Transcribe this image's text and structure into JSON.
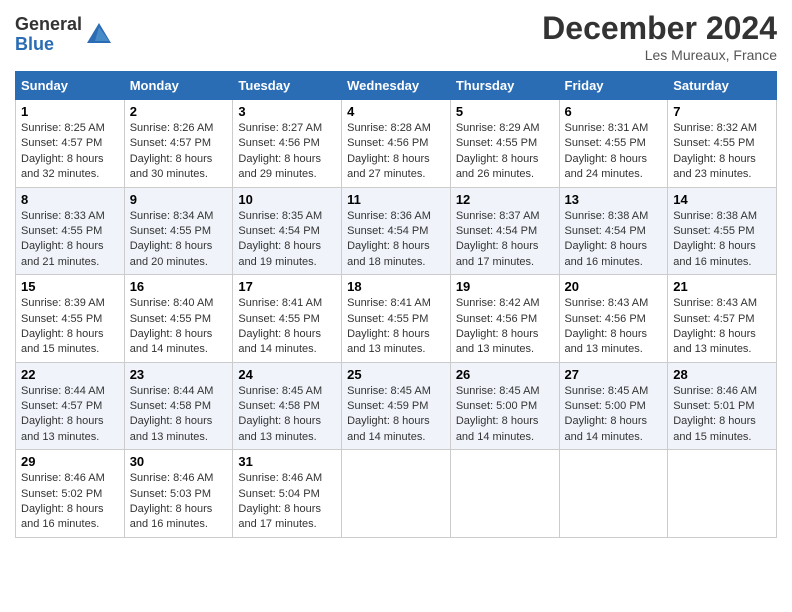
{
  "logo": {
    "general": "General",
    "blue": "Blue"
  },
  "header": {
    "title": "December 2024",
    "location": "Les Mureaux, France"
  },
  "days_of_week": [
    "Sunday",
    "Monday",
    "Tuesday",
    "Wednesday",
    "Thursday",
    "Friday",
    "Saturday"
  ],
  "weeks": [
    [
      {
        "day": 1,
        "sunrise": "8:25 AM",
        "sunset": "4:57 PM",
        "daylight": "8 hours and 32 minutes."
      },
      {
        "day": 2,
        "sunrise": "8:26 AM",
        "sunset": "4:57 PM",
        "daylight": "8 hours and 30 minutes."
      },
      {
        "day": 3,
        "sunrise": "8:27 AM",
        "sunset": "4:56 PM",
        "daylight": "8 hours and 29 minutes."
      },
      {
        "day": 4,
        "sunrise": "8:28 AM",
        "sunset": "4:56 PM",
        "daylight": "8 hours and 27 minutes."
      },
      {
        "day": 5,
        "sunrise": "8:29 AM",
        "sunset": "4:55 PM",
        "daylight": "8 hours and 26 minutes."
      },
      {
        "day": 6,
        "sunrise": "8:31 AM",
        "sunset": "4:55 PM",
        "daylight": "8 hours and 24 minutes."
      },
      {
        "day": 7,
        "sunrise": "8:32 AM",
        "sunset": "4:55 PM",
        "daylight": "8 hours and 23 minutes."
      }
    ],
    [
      {
        "day": 8,
        "sunrise": "8:33 AM",
        "sunset": "4:55 PM",
        "daylight": "8 hours and 21 minutes."
      },
      {
        "day": 9,
        "sunrise": "8:34 AM",
        "sunset": "4:55 PM",
        "daylight": "8 hours and 20 minutes."
      },
      {
        "day": 10,
        "sunrise": "8:35 AM",
        "sunset": "4:54 PM",
        "daylight": "8 hours and 19 minutes."
      },
      {
        "day": 11,
        "sunrise": "8:36 AM",
        "sunset": "4:54 PM",
        "daylight": "8 hours and 18 minutes."
      },
      {
        "day": 12,
        "sunrise": "8:37 AM",
        "sunset": "4:54 PM",
        "daylight": "8 hours and 17 minutes."
      },
      {
        "day": 13,
        "sunrise": "8:38 AM",
        "sunset": "4:54 PM",
        "daylight": "8 hours and 16 minutes."
      },
      {
        "day": 14,
        "sunrise": "8:38 AM",
        "sunset": "4:55 PM",
        "daylight": "8 hours and 16 minutes."
      }
    ],
    [
      {
        "day": 15,
        "sunrise": "8:39 AM",
        "sunset": "4:55 PM",
        "daylight": "8 hours and 15 minutes."
      },
      {
        "day": 16,
        "sunrise": "8:40 AM",
        "sunset": "4:55 PM",
        "daylight": "8 hours and 14 minutes."
      },
      {
        "day": 17,
        "sunrise": "8:41 AM",
        "sunset": "4:55 PM",
        "daylight": "8 hours and 14 minutes."
      },
      {
        "day": 18,
        "sunrise": "8:41 AM",
        "sunset": "4:55 PM",
        "daylight": "8 hours and 13 minutes."
      },
      {
        "day": 19,
        "sunrise": "8:42 AM",
        "sunset": "4:56 PM",
        "daylight": "8 hours and 13 minutes."
      },
      {
        "day": 20,
        "sunrise": "8:43 AM",
        "sunset": "4:56 PM",
        "daylight": "8 hours and 13 minutes."
      },
      {
        "day": 21,
        "sunrise": "8:43 AM",
        "sunset": "4:57 PM",
        "daylight": "8 hours and 13 minutes."
      }
    ],
    [
      {
        "day": 22,
        "sunrise": "8:44 AM",
        "sunset": "4:57 PM",
        "daylight": "8 hours and 13 minutes."
      },
      {
        "day": 23,
        "sunrise": "8:44 AM",
        "sunset": "4:58 PM",
        "daylight": "8 hours and 13 minutes."
      },
      {
        "day": 24,
        "sunrise": "8:45 AM",
        "sunset": "4:58 PM",
        "daylight": "8 hours and 13 minutes."
      },
      {
        "day": 25,
        "sunrise": "8:45 AM",
        "sunset": "4:59 PM",
        "daylight": "8 hours and 14 minutes."
      },
      {
        "day": 26,
        "sunrise": "8:45 AM",
        "sunset": "5:00 PM",
        "daylight": "8 hours and 14 minutes."
      },
      {
        "day": 27,
        "sunrise": "8:45 AM",
        "sunset": "5:00 PM",
        "daylight": "8 hours and 14 minutes."
      },
      {
        "day": 28,
        "sunrise": "8:46 AM",
        "sunset": "5:01 PM",
        "daylight": "8 hours and 15 minutes."
      }
    ],
    [
      {
        "day": 29,
        "sunrise": "8:46 AM",
        "sunset": "5:02 PM",
        "daylight": "8 hours and 16 minutes."
      },
      {
        "day": 30,
        "sunrise": "8:46 AM",
        "sunset": "5:03 PM",
        "daylight": "8 hours and 16 minutes."
      },
      {
        "day": 31,
        "sunrise": "8:46 AM",
        "sunset": "5:04 PM",
        "daylight": "8 hours and 17 minutes."
      },
      null,
      null,
      null,
      null
    ]
  ],
  "labels": {
    "sunrise": "Sunrise:",
    "sunset": "Sunset:",
    "daylight": "Daylight:"
  }
}
